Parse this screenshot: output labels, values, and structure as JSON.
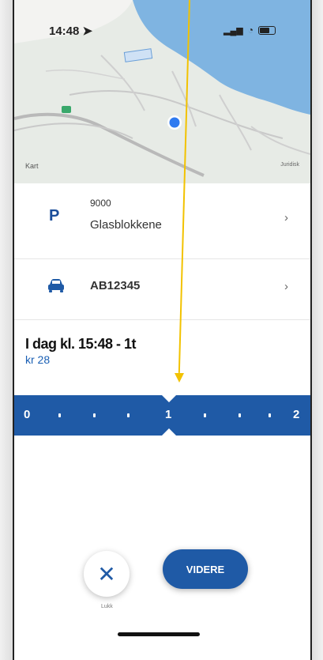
{
  "status": {
    "time": "14:48"
  },
  "map": {
    "kart_label": "Kart",
    "legal_label": "Juridisk"
  },
  "zone": {
    "code": "9000",
    "name": "Glasblokkene"
  },
  "vehicle": {
    "plate": "AB12345"
  },
  "summary": {
    "time_text": "I dag kl. 15:48 - 1t",
    "price": "kr 28"
  },
  "slider": {
    "labels": [
      "0",
      "1",
      "2"
    ],
    "selected_hours": 1
  },
  "actions": {
    "close_label": "Lukk",
    "next_label": "VIDERE"
  },
  "colors": {
    "primary": "#1f5aa6",
    "annotation": "#f2c200"
  }
}
